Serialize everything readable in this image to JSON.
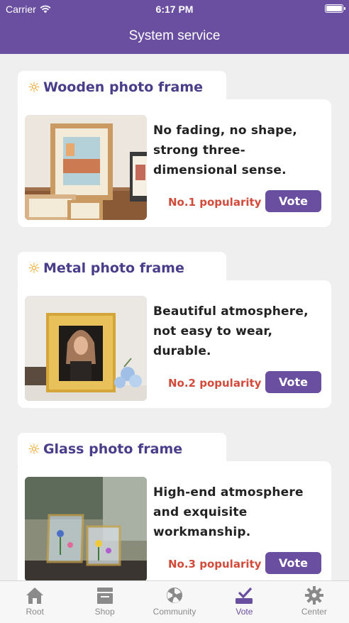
{
  "status_bar": {
    "carrier": "Carrier",
    "time": "6:17 PM"
  },
  "nav": {
    "title": "System service"
  },
  "sections": [
    {
      "title": "Wooden photo frame",
      "description": "No fading, no shape, strong three-dimensional sense.",
      "popularity": "No.1 popularity",
      "vote_label": "Vote",
      "image": "wooden-frame-photo"
    },
    {
      "title": "Metal photo frame",
      "description": "Beautiful atmosphere, not easy to wear, durable.",
      "popularity": "No.2 popularity",
      "vote_label": "Vote",
      "image": "metal-frame-photo"
    },
    {
      "title": "Glass photo frame",
      "description": "High-end atmosphere and exquisite workmanship.",
      "popularity": "No.3 popularity",
      "vote_label": "Vote",
      "image": "glass-frame-photo"
    }
  ],
  "tabbar": {
    "items": [
      {
        "label": "Root",
        "icon": "home-icon"
      },
      {
        "label": "Shop",
        "icon": "shop-icon"
      },
      {
        "label": "Community",
        "icon": "community-icon"
      },
      {
        "label": "Vote",
        "icon": "vote-icon",
        "active": true
      },
      {
        "label": "Center",
        "icon": "gear-icon"
      }
    ]
  },
  "colors": {
    "primary": "#6a4fa1",
    "popularity": "#d24a3a",
    "title": "#4a3d8a",
    "background": "#efefef"
  }
}
